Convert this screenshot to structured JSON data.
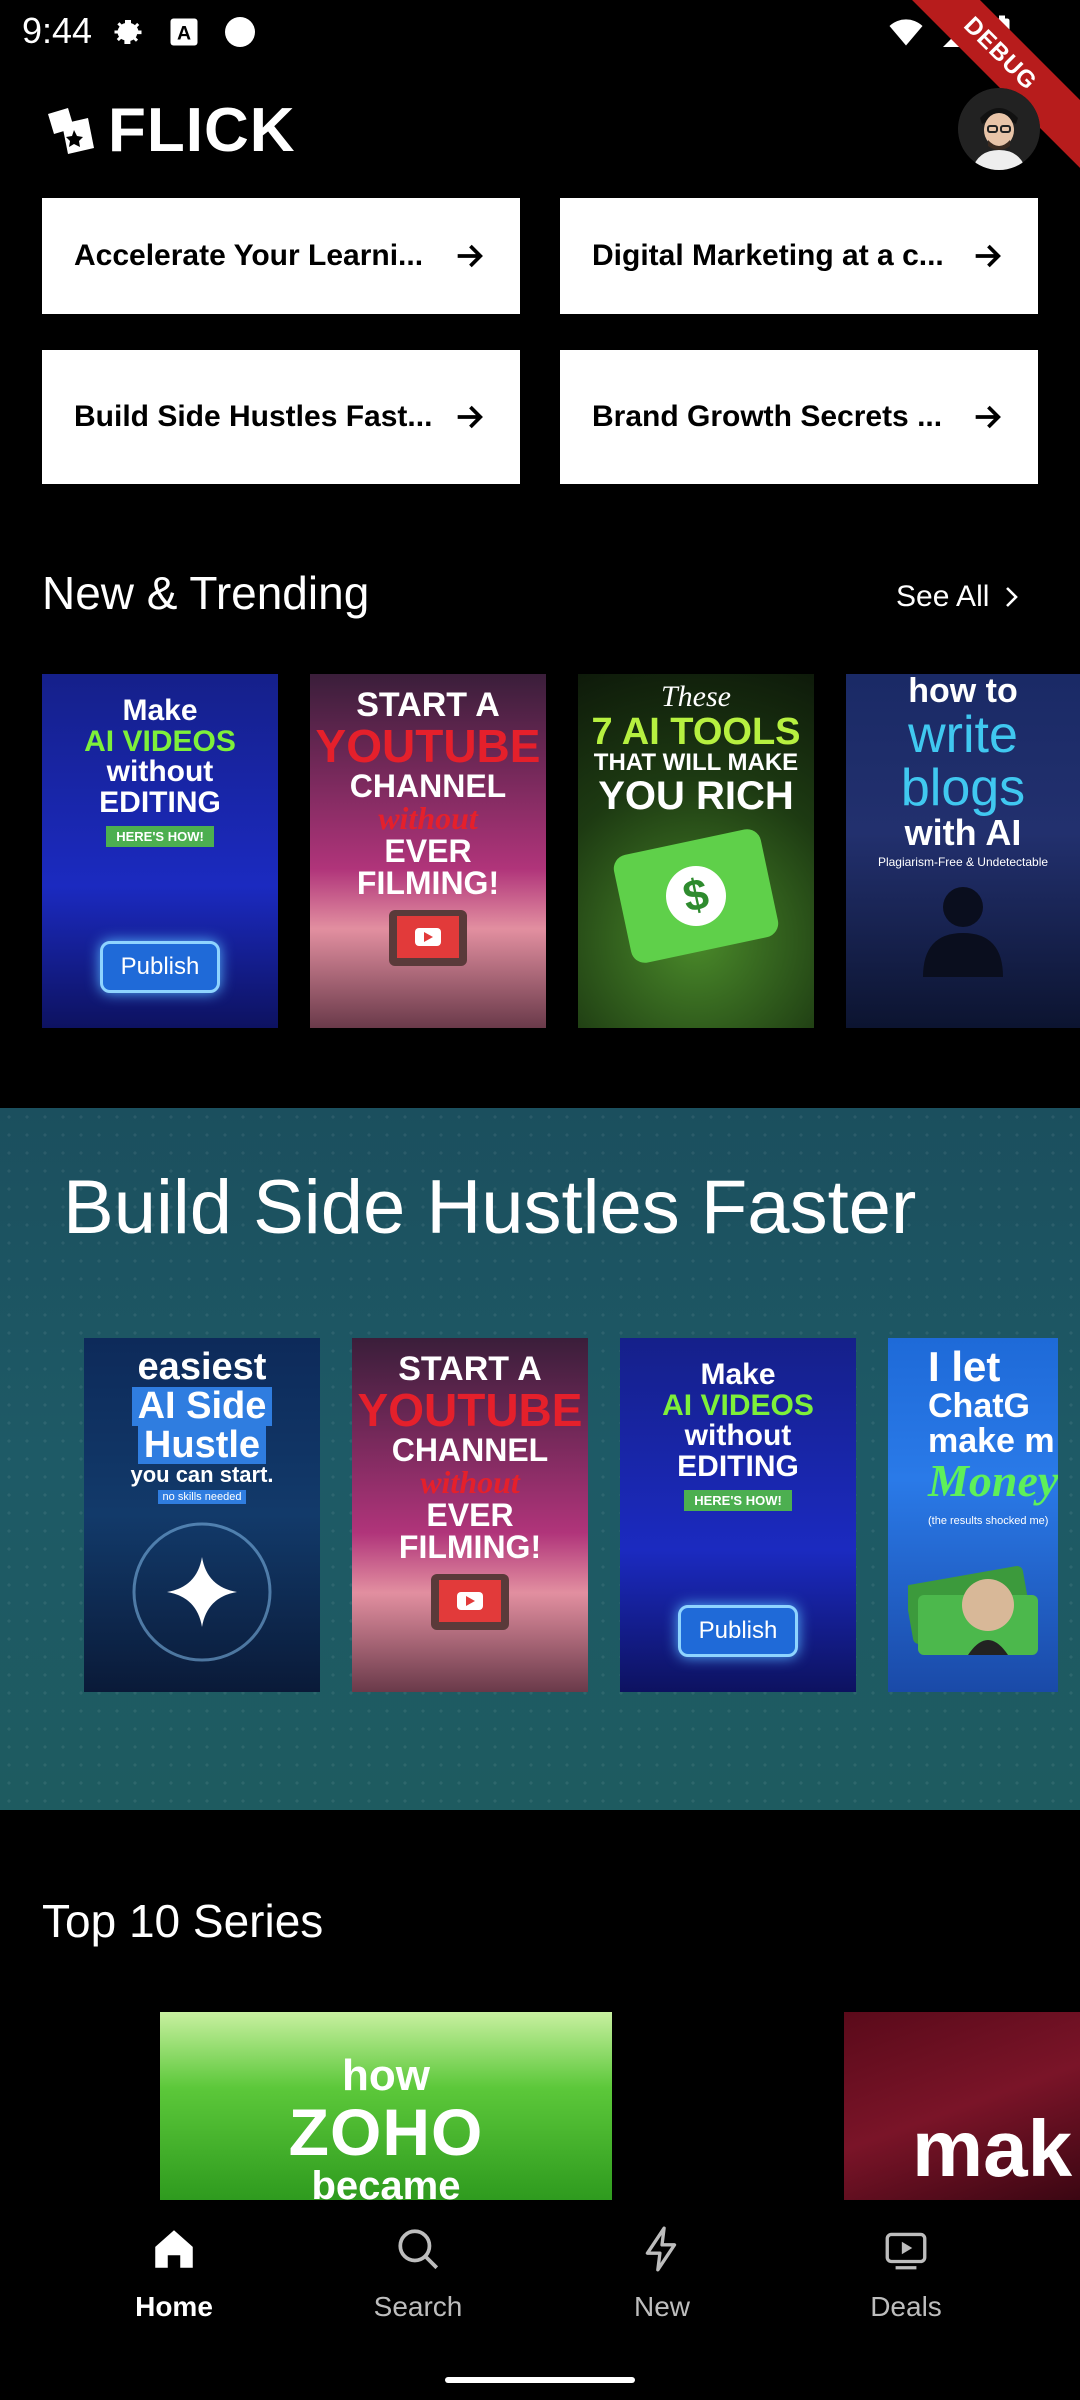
{
  "status_bar": {
    "time": "9:44",
    "debug_label": "DEBUG"
  },
  "app": {
    "name": "FLICK"
  },
  "quick_links": [
    {
      "label": "Accelerate Your Learni..."
    },
    {
      "label": "Digital Marketing at a c..."
    },
    {
      "label": "Build Side Hustles Fast..."
    },
    {
      "label": "Brand Growth Secrets ..."
    }
  ],
  "new_trending": {
    "title": "New & Trending",
    "see_all": "See All",
    "posters": [
      {
        "lines": [
          "Make",
          "AI VIDEOS",
          "without",
          "EDITING"
        ],
        "tag": "HERE'S HOW!",
        "button": "Publish"
      },
      {
        "lines": [
          "START A",
          "YOUTUBE",
          "CHANNEL",
          "without",
          "EVER FILMING!"
        ]
      },
      {
        "lines": [
          "These",
          "7 AI TOOLS",
          "THAT WILL MAKE",
          "YOU RICH"
        ],
        "icon": "$"
      },
      {
        "lines": [
          "how to",
          "write",
          "blogs",
          "with AI"
        ],
        "tag": "Plagiarism-Free & Undetectable"
      }
    ]
  },
  "hustle_banner": {
    "title": "Build Side Hustles Faster",
    "posters": [
      {
        "lines": [
          "easiest",
          "AI Side",
          "Hustle",
          "you can start."
        ],
        "tag": "no skills needed"
      },
      {
        "lines": [
          "START A",
          "YOUTUBE",
          "CHANNEL",
          "without",
          "EVER FILMING!"
        ]
      },
      {
        "lines": [
          "Make",
          "AI VIDEOS",
          "without",
          "EDITING"
        ],
        "tag": "HERE'S HOW!",
        "button": "Publish"
      },
      {
        "lines": [
          "I let",
          "ChatG",
          "make m",
          "Money"
        ],
        "tag": "(the results shocked me)"
      }
    ]
  },
  "top10": {
    "title": "Top 10 Series",
    "cards": [
      {
        "lines": [
          "how",
          "ZOHO",
          "became"
        ]
      },
      {
        "lines": [
          "mak"
        ]
      }
    ]
  },
  "nav": [
    {
      "label": "Home",
      "icon": "home-icon",
      "active": true
    },
    {
      "label": "Search",
      "icon": "search-icon",
      "active": false
    },
    {
      "label": "New",
      "icon": "bolt-icon",
      "active": false
    },
    {
      "label": "Deals",
      "icon": "play-tv-icon",
      "active": false
    }
  ]
}
